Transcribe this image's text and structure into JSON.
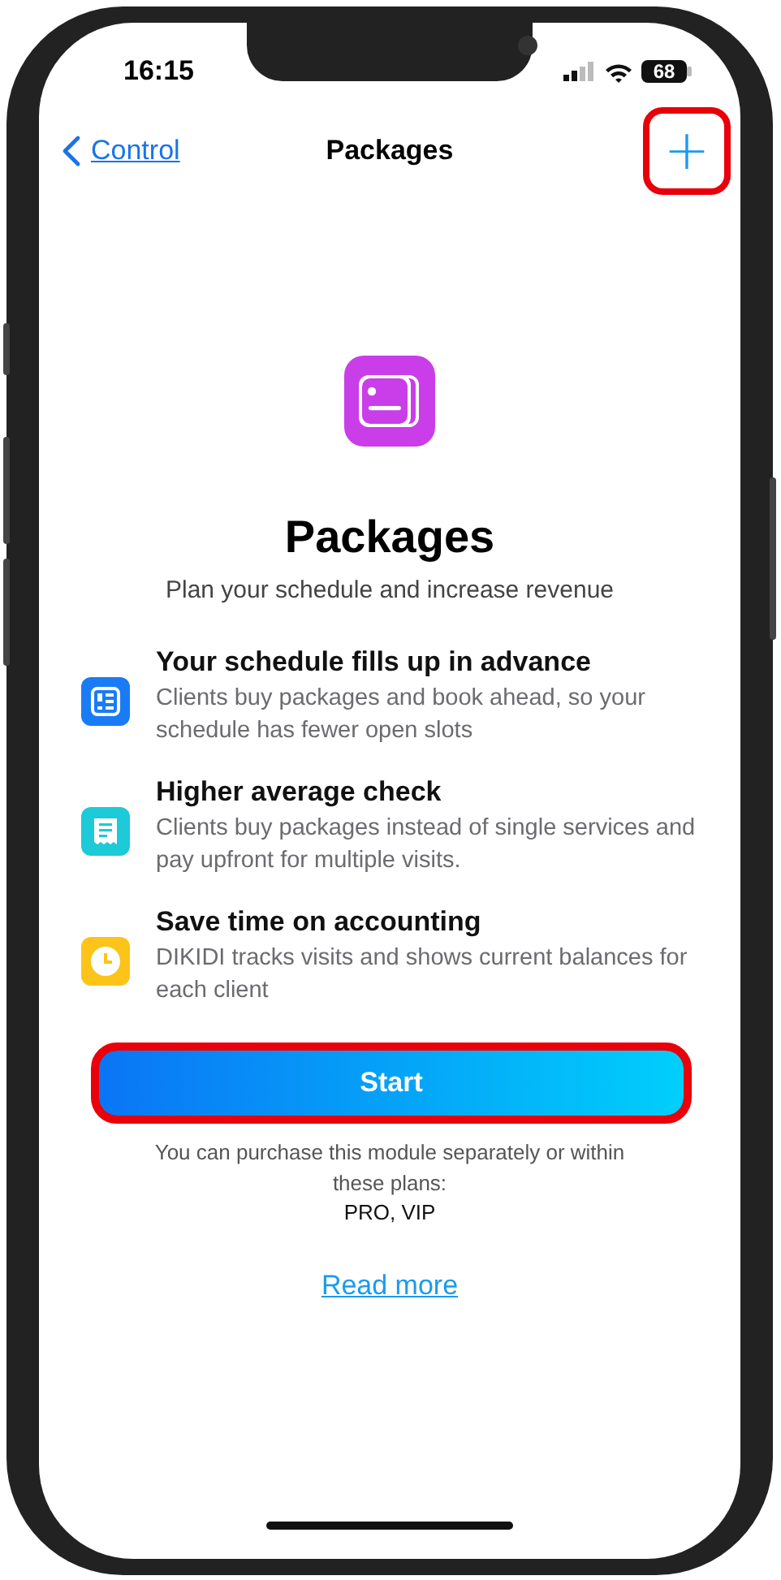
{
  "status_bar": {
    "time": "16:15",
    "battery": "68"
  },
  "nav": {
    "back_label": "Control",
    "title": "Packages",
    "add_button": {
      "label": "+",
      "highlighted": true
    }
  },
  "hero": {
    "title": "Packages",
    "subtitle": "Plan your schedule and increase revenue"
  },
  "features": [
    {
      "kind": "calendar",
      "color": "#1a7cf5",
      "title": "Your schedule fills up in advance",
      "description": "Clients buy packages and book ahead, so your schedule has fewer open slots"
    },
    {
      "kind": "receipt",
      "color": "#1ccad8",
      "title": "Higher average check",
      "description": "Clients buy packages instead of single services and pay upfront for multiple visits."
    },
    {
      "kind": "clock",
      "color": "#fcc419",
      "title": "Save time on accounting",
      "description": "DIKIDI tracks visits and shows current balances for each client"
    }
  ],
  "start_button": {
    "label": "Start",
    "highlighted": true
  },
  "note": "You can purchase this module separately or within these plans:",
  "plans": "PRO, VIP",
  "read_more": "Read more"
}
